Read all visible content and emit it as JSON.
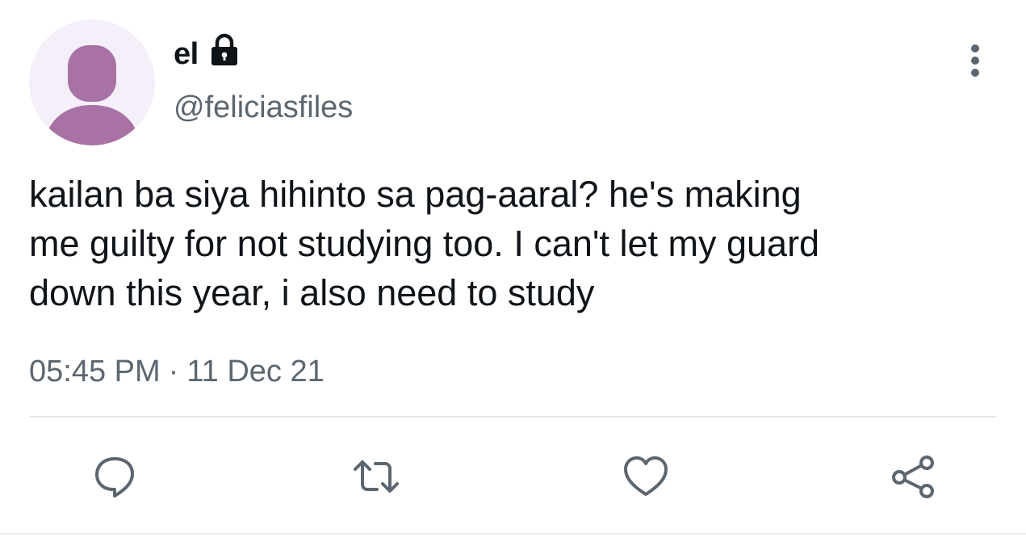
{
  "user": {
    "display_name": "el",
    "handle": "@feliciasfiles",
    "avatar_icon": "default-profile-icon",
    "protected_icon": "lock-icon"
  },
  "tweet": {
    "lines": [
      "kailan ba siya hihinto sa pag-aaral? he's making",
      "me guilty for not studying too. I can't let my guard",
      "down this year, i also need to study"
    ]
  },
  "meta": {
    "time": "05:45 PM",
    "separator": "·",
    "date": "11 Dec 21"
  },
  "actions": {
    "reply_icon": "reply-icon",
    "retweet_icon": "retweet-icon",
    "like_icon": "heart-icon",
    "share_icon": "share-icon",
    "more_icon": "more-vertical-icon"
  },
  "colors": {
    "text_primary": "#0f1419",
    "text_secondary": "#5b6670",
    "avatar_bg": "#f5eff9",
    "avatar_figure": "#a872a4",
    "divider": "#e6e9ec"
  }
}
